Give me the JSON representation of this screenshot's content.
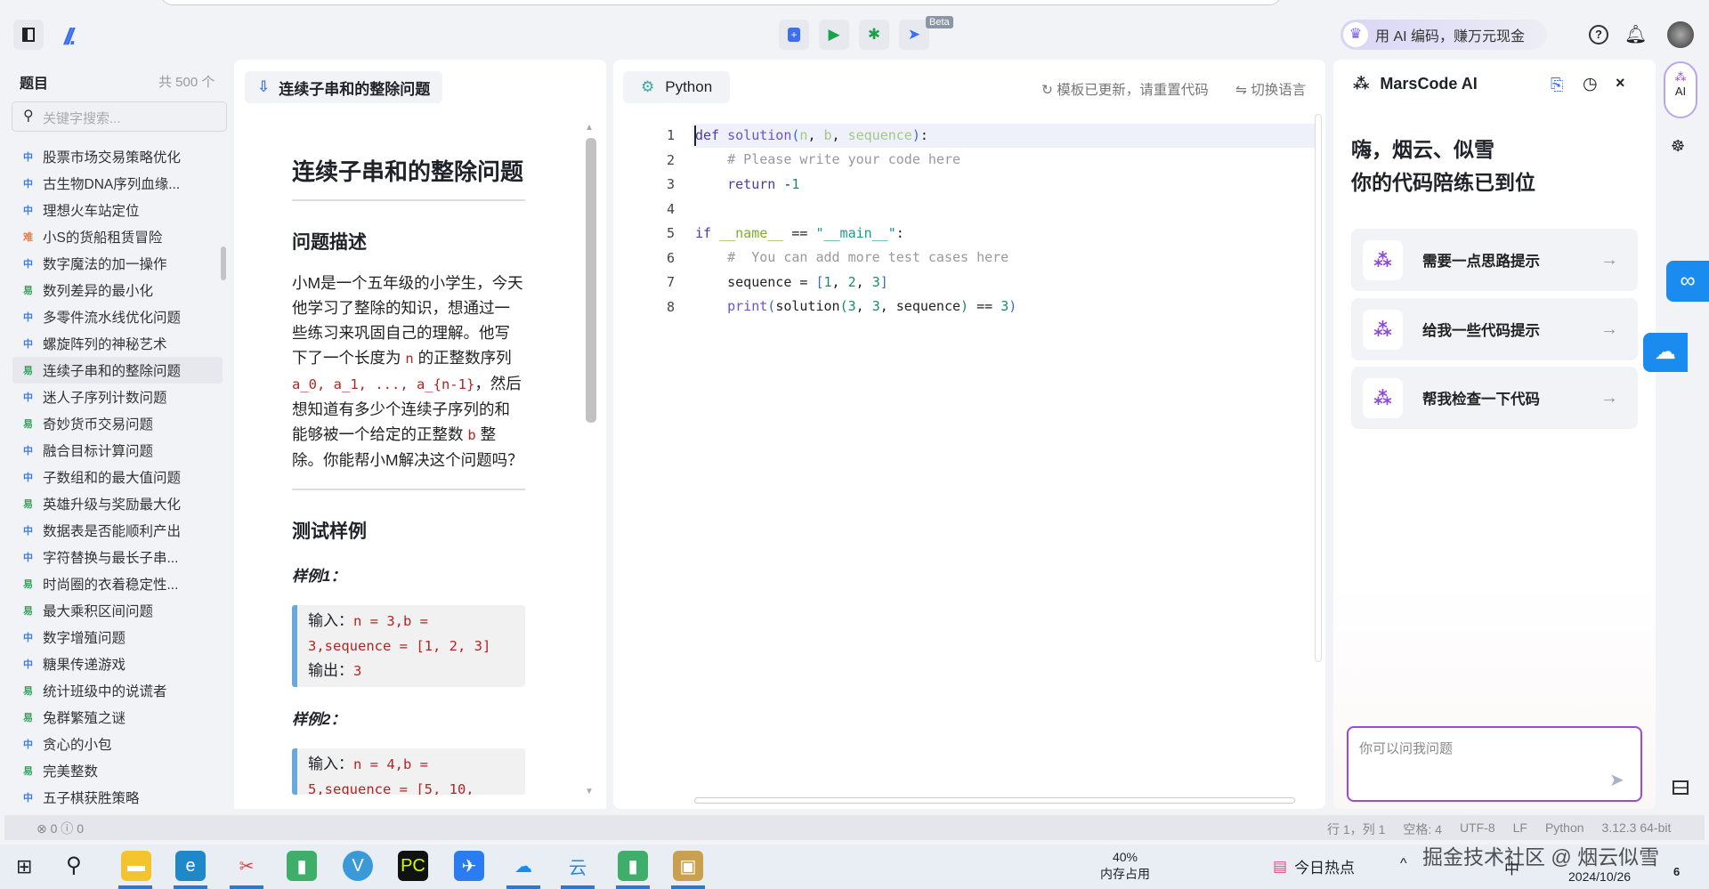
{
  "toolbar": {
    "beta": "Beta",
    "promo": "用 AI 编码，赚万元现金"
  },
  "sidebar": {
    "title": "题目",
    "count": "共 500 个",
    "search_placeholder": "关键字搜索...",
    "items": [
      {
        "level": "中",
        "label": "股票市场交易策略优化"
      },
      {
        "level": "中",
        "label": "古生物DNA序列血缘..."
      },
      {
        "level": "中",
        "label": "理想火车站定位"
      },
      {
        "level": "难",
        "label": "小S的货船租赁冒险"
      },
      {
        "level": "中",
        "label": "数字魔法的加一操作"
      },
      {
        "level": "易",
        "label": "数列差异的最小化"
      },
      {
        "level": "中",
        "label": "多零件流水线优化问题"
      },
      {
        "level": "中",
        "label": "螺旋阵列的神秘艺术"
      },
      {
        "level": "易",
        "label": "连续子串和的整除问题",
        "active": true
      },
      {
        "level": "中",
        "label": "迷人子序列计数问题"
      },
      {
        "level": "易",
        "label": "奇妙货币交易问题"
      },
      {
        "level": "中",
        "label": "融合目标计算问题"
      },
      {
        "level": "中",
        "label": "子数组和的最大值问题"
      },
      {
        "level": "易",
        "label": "英雄升级与奖励最大化"
      },
      {
        "level": "中",
        "label": "数据表是否能顺利产出"
      },
      {
        "level": "中",
        "label": "字符替换与最长子串..."
      },
      {
        "level": "易",
        "label": "时尚圈的衣着稳定性..."
      },
      {
        "level": "易",
        "label": "最大乘积区间问题"
      },
      {
        "level": "中",
        "label": "数字增殖问题"
      },
      {
        "level": "中",
        "label": "糖果传递游戏"
      },
      {
        "level": "易",
        "label": "统计班级中的说谎者"
      },
      {
        "level": "易",
        "label": "兔群繁殖之谜"
      },
      {
        "level": "中",
        "label": "贪心的小包"
      },
      {
        "level": "易",
        "label": "完美整数"
      },
      {
        "level": "中",
        "label": "五子棋获胜策略"
      }
    ]
  },
  "problem": {
    "tab": "连续子串和的整除问题",
    "title": "连续子串和的整除问题",
    "desc_heading": "问题描述",
    "desc": [
      "小M是一个五年级的小学生，今天他学习了整除的知识，想通过一些练习来巩固自己的理解。他写下了一个长度为 ",
      "n",
      " 的正整数序列 ",
      "a_0, a_1, ..., a_{n-1}",
      "，然后想知道有多少个连续子序列的和能够被一个给定的正整数 ",
      "b",
      " 整除。你能帮小M解决这个问题吗？"
    ],
    "tests_heading": "测试样例",
    "examples": [
      {
        "label": "样例1：",
        "in_label": "输入：",
        "input": "n = 3,b = 3,sequence = [1, 2, 3]",
        "out_label": "输出：",
        "output": "3"
      },
      {
        "label": "样例2：",
        "in_label": "输入：",
        "input": "n = 4,b = 5,sequence = [5, 10,"
      }
    ]
  },
  "editor": {
    "language": "Python",
    "reset_hint": "模板已更新，请重置代码",
    "switch_lang": "切换语言",
    "lines": [
      "1",
      "2",
      "3",
      "4",
      "5",
      "6",
      "7",
      "8"
    ]
  },
  "ai": {
    "title": "MarsCode AI",
    "greet1": "嗨，烟云、似雪",
    "greet2": "你的代码陪练已到位",
    "cards": [
      "需要一点思路提示",
      "给我一些代码提示",
      "帮我检查一下代码"
    ],
    "placeholder": "你可以问我问题",
    "rail_label": "AI"
  },
  "status": {
    "errors": "0",
    "warnings": "0",
    "position": "行 1，列 1",
    "spaces": "空格: 4",
    "encoding": "UTF-8",
    "eol": "LF",
    "lang": "Python",
    "interpreter": "3.12.3 64-bit"
  },
  "taskbar": {
    "mem_pct": "40%",
    "mem_label": "内存占用",
    "news": "今日热点",
    "ime": "中",
    "date": "2024/10/26",
    "notif": "6",
    "watermark": "掘金技术社区 @ 烟云似雪"
  }
}
